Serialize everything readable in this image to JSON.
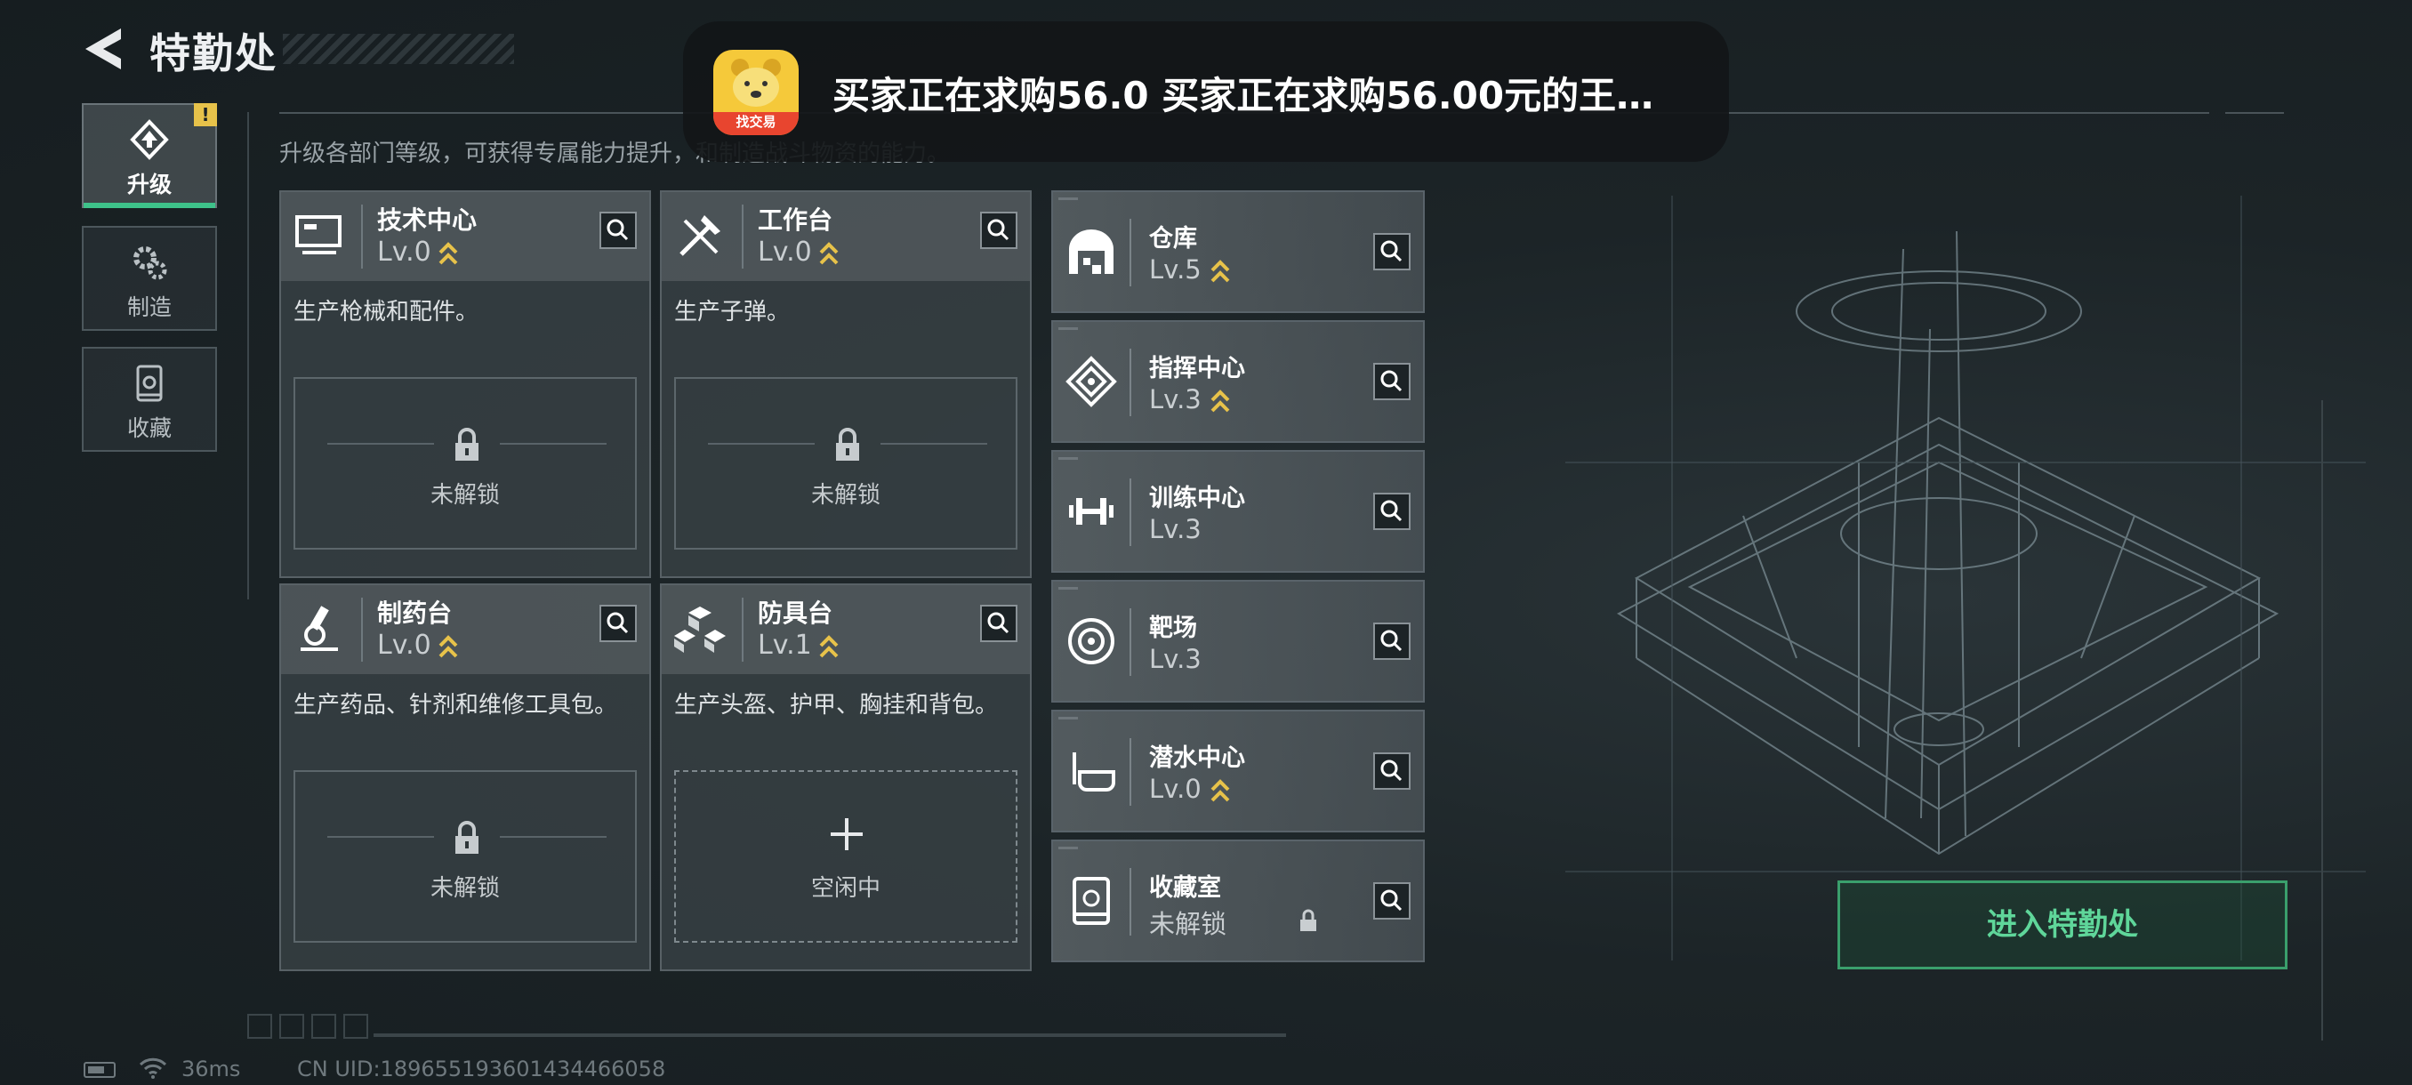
{
  "header": {
    "title": "特勤处"
  },
  "nav": [
    {
      "label": "升级",
      "icon": "upgrade-icon",
      "active": true,
      "badge": "!"
    },
    {
      "label": "制造",
      "icon": "gear-icon",
      "active": false
    },
    {
      "label": "收藏",
      "icon": "collection-icon",
      "active": false
    }
  ],
  "description": "升级各部门等级，可获得专属能力提升，和制造战斗物资的能力。",
  "departments": [
    {
      "name": "技术中心",
      "level": "Lv.0",
      "desc": "生产枪械和配件。",
      "slot": "未解锁",
      "upgradable": true,
      "icon": "computer-icon"
    },
    {
      "name": "工作台",
      "level": "Lv.0",
      "desc": "生产子弹。",
      "slot": "未解锁",
      "upgradable": true,
      "icon": "tools-icon"
    },
    {
      "name": "制药台",
      "level": "Lv.0",
      "desc": "生产药品、针剂和维修工具包。",
      "slot": "未解锁",
      "upgradable": true,
      "icon": "microscope-icon"
    },
    {
      "name": "防具台",
      "level": "Lv.1",
      "desc": "生产头盔、护甲、胸挂和背包。",
      "slot": "空闲中",
      "upgradable": true,
      "icon": "armor-boxes-icon"
    }
  ],
  "facilities": [
    {
      "name": "仓库",
      "level": "Lv.5",
      "upgradable": true,
      "icon": "warehouse-icon"
    },
    {
      "name": "指挥中心",
      "level": "Lv.3",
      "upgradable": true,
      "icon": "command-icon"
    },
    {
      "name": "训练中心",
      "level": "Lv.3",
      "upgradable": false,
      "icon": "dumbbell-icon"
    },
    {
      "name": "靶场",
      "level": "Lv.3",
      "upgradable": false,
      "icon": "target-icon"
    },
    {
      "name": "潜水中心",
      "level": "Lv.0",
      "upgradable": true,
      "icon": "diving-mask-icon"
    },
    {
      "name": "收藏室",
      "level": "未解锁",
      "upgradable": false,
      "locked": true,
      "icon": "display-case-icon"
    }
  ],
  "notification": {
    "message": "买家正在求购56.0  买家正在求购56.00元的王…",
    "app_badge": "找交易"
  },
  "enter_button": "进入特勤处",
  "status_bar": {
    "ping": "36ms",
    "uid": "CN UID:1896551936014344660​58"
  },
  "colors": {
    "accent": "#3ec28a",
    "upgrade": "#e7c24a",
    "enter": "#5fd69a"
  }
}
